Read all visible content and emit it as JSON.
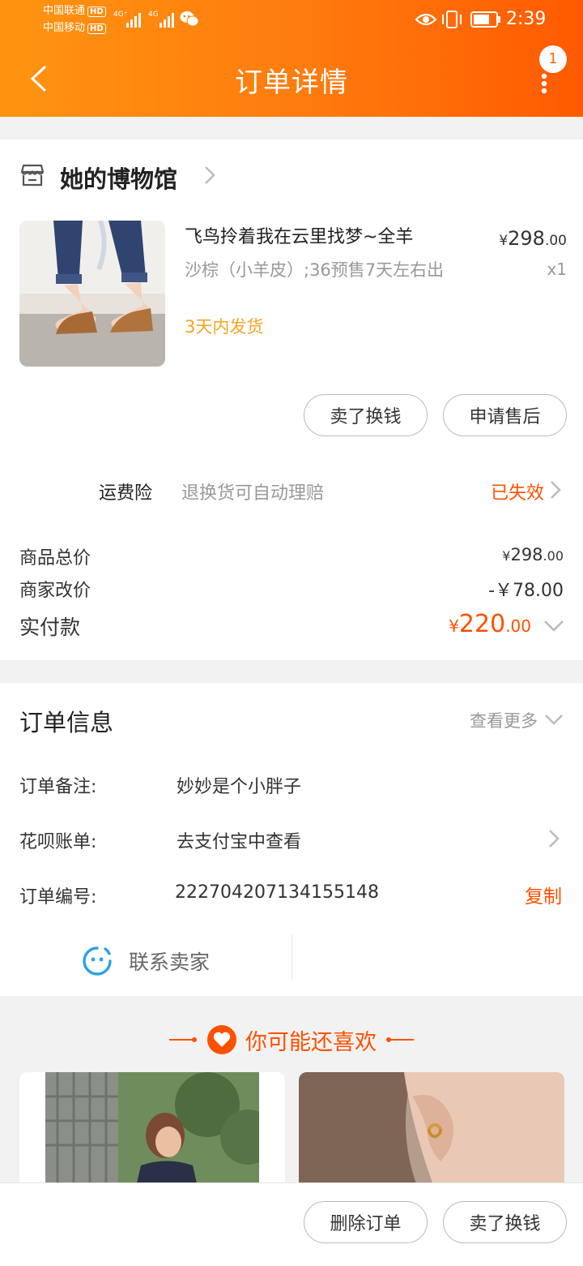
{
  "status_bar": {
    "carrier1": "中国联通",
    "carrier2": "中国移动",
    "hd": "HD",
    "net1": "4G⁺",
    "net2": "4G",
    "time": "2:39"
  },
  "header": {
    "title": "订单详情",
    "notification_count": "1"
  },
  "shop": {
    "name": "她的博物馆"
  },
  "product": {
    "title": "飞鸟拎着我在云里找梦~全羊",
    "sku": "沙棕（小羊皮）;36预售7天左右出",
    "shipping": "3天内发货",
    "price_symbol": "¥",
    "price_int": "298",
    "price_dec": ".00",
    "qty": "x1"
  },
  "product_actions": {
    "sell_button": "卖了换钱",
    "after_sale_button": "申请售后"
  },
  "insurance": {
    "label": "运费险",
    "desc": "退换货可自动理赔",
    "status": "已失效"
  },
  "price_summary": {
    "total_label": "商品总价",
    "total_symbol": "¥",
    "total_int": "298",
    "total_dec": ".00",
    "discount_label": "商家改价",
    "discount_value": "-￥78.00",
    "paid_label": "实付款",
    "paid_symbol": "¥",
    "paid_int": "220",
    "paid_dec": ".00"
  },
  "order_info": {
    "title": "订单信息",
    "more": "查看更多",
    "note_label": "订单备注:",
    "note_value": "妙妙是个小胖子",
    "huabei_label": "花呗账单:",
    "huabei_value": "去支付宝中查看",
    "order_no_label": "订单编号:",
    "order_no_value": "222704207134155148",
    "copy": "复制",
    "contact": "联系卖家"
  },
  "recommend": {
    "title": "你可能还喜欢"
  },
  "bottom_bar": {
    "delete_button": "删除订单",
    "sell_button": "卖了换钱"
  },
  "colors": {
    "accent": "#ff5000",
    "header_start": "#ff9410",
    "header_end": "#ff5a00",
    "ship_text": "#f5a623"
  }
}
